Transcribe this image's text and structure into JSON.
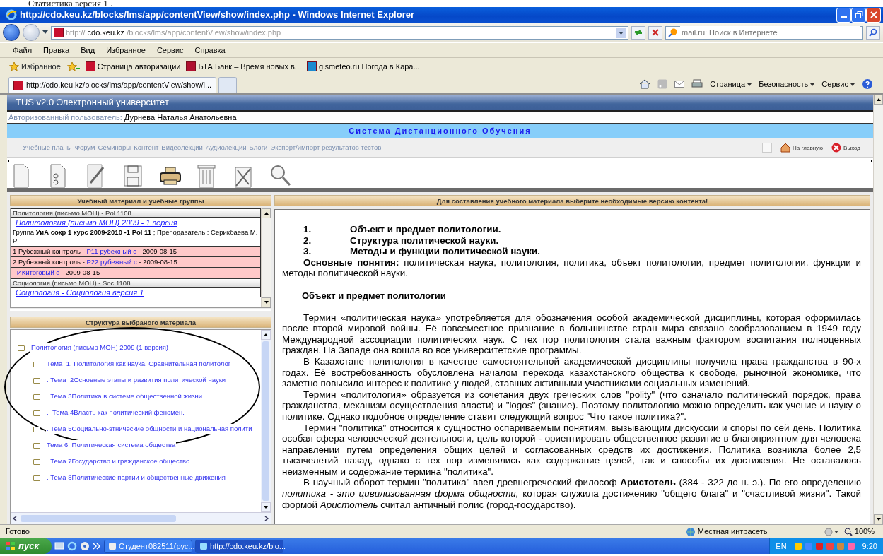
{
  "document_caption": "Статистика версия 1 .",
  "window": {
    "title": "http://cdo.keu.kz/blocks/lms/app/contentView/show/index.php - Windows Internet Explorer"
  },
  "address_bar": {
    "scheme": "http://",
    "host": "cdo.keu.kz",
    "path": "/blocks/lms/app/contentView/show/index.php"
  },
  "search": {
    "placeholder": "mail.ru: Поиск в Интернете"
  },
  "menu": [
    "Файл",
    "Правка",
    "Вид",
    "Избранное",
    "Сервис",
    "Справка"
  ],
  "favorites_bar": {
    "label": "Избранное",
    "links": [
      "Страница авторизации",
      "БТА Банк – Время новых в...",
      "gismeteo.ru Погода в Кара..."
    ]
  },
  "tabs": [
    {
      "label": "http://cdo.keu.kz/blocks/lms/app/contentView/show/i...",
      "selected": true
    }
  ],
  "command_bar": [
    "Страница",
    "Безопасность",
    "Сервис"
  ],
  "page": {
    "header": "TUS v2.0 Электронный университет",
    "user_label": "Авторизованный пользователь:",
    "user_name": "Дурнева Наталья Анатольевна",
    "system_title": "Система Дистанционного Обучения",
    "nav": [
      "Учебные планы",
      "Форум",
      "Семинары",
      "Контент",
      "Видеолекции",
      "Аудиолекции",
      "Блоги",
      "Экспорт/импорт результатов тестов"
    ],
    "home_link": "На главную",
    "logout_link": "Выход",
    "materials_panel": {
      "title": "Учебный материал и учебные группы",
      "rows": [
        {
          "kind": "header",
          "text": "Политология (письмо МОН) - Pol 1108"
        },
        {
          "kind": "link",
          "text": "Политология (письмо МОН) 2009 - 1 версия"
        },
        {
          "kind": "group",
          "text": "Группа **УиА сокр 1 курс 2009-2010 -1 Pol 11** ; Преподаватель : Серикбаева М. Р"
        },
        {
          "kind": "control",
          "prefix": "1 Рубежный контроль - ",
          "link": "P11 рубежный с",
          "suffix": " - 2009-08-15"
        },
        {
          "kind": "control",
          "prefix": "2 Рубежный контроль - ",
          "link": "P22 рубежный с",
          "suffix": " - 2009-08-15"
        },
        {
          "kind": "control",
          "prefix": "- ",
          "link": "ИКитоговый с",
          "suffix": " - 2009-08-15"
        },
        {
          "kind": "header",
          "text": "Социология (письмо МОН) - Soc 1108"
        },
        {
          "kind": "link",
          "text": "Социология - Социология версия 1"
        }
      ]
    },
    "structure_panel": {
      "title": "Структура выбраного материала",
      "tree": [
        {
          "label": "Политология (письмо МОН) 2009 (1 версия)",
          "children": [
            {
              "label": "Тема  1. Политология как наука. Сравнительная политолог"
            },
            {
              "label": ". Тема  2Основные этапы и развития политической науки"
            },
            {
              "label": ". Тема 3Политика в системе общественной жизни"
            },
            {
              "label": ".  Тема 4Власть как политический феномен."
            },
            {
              "label": ". Тема 5Социально-этнические общности и национальная полити"
            },
            {
              "label": "Тема 6. Политическая система общества"
            },
            {
              "label": ". Тема 7Государство и гражданское общество"
            },
            {
              "label": ". Тема 8Политические партии и общественные движения"
            }
          ]
        }
      ]
    },
    "content_panel": {
      "title": "Для составления учебного материала выберите необходимые версию контента!",
      "outline": [
        {
          "number": "1.",
          "text": "Объект и предмет политологии."
        },
        {
          "number": "2.",
          "text": "Структура политической науки."
        },
        {
          "number": "3.",
          "text": "Методы и функции политической науки."
        }
      ],
      "concepts": "**Основные понятия:** политическая наука, политология, политика, объект политологии, предмет политологии, функции и методы политической науки.",
      "heading": "Объект и предмет политологии",
      "paragraphs": [
        "Термин «политическая наука» употребляется для обозначения особой академической дисциплины, которая оформилась после второй мировой войны. Её повсеместное признание в большинстве стран мира связано сообразованием в 1949 году Международной ассоциации политических наук. С тех пор политология стала важным фактором воспитания полноценных граждан. На Западе она вошла во все университетские программы.",
        "В Казахстане политология в качестве самостоятельной академической дисциплины получила права гражданства в 90-х годах. Её востребованность  обусловлена началом перехода казахстанского общества к свободе, рыночной экономике, что заметно повысило интерес к политике у людей, ставших активными участниками социальных изменений.",
        "Термин «политология» образуется из сочетания двух греческих слов \"polity\" (что означало политический порядок, права гражданства, механизм осуществления власти) и \"logos\" (знание). Поэтому политологию можно определить как учение и науку о политике. Однако подобное определение ставит следующий вопрос \"Что такое политика?\".",
        "Термин \"политика\" относится к сущностно оспариваемым понятиям, вызывающим дискуссии и споры по сей день. Политика особая сфера человеческой деятельности, цель которой - ориентировать общественное развитие в благоприятном для человека направлении путем определения общих целей и согласованных средств их достижения. Политика возникла более 2,5 тысячелетий назад, однако с тех пор изменялись как содержание целей, так и способы их достижения. Не оставалось неизменным и содержание термина \"политика\".",
        "В научный оборот термин \"политика\" ввел древнегреческий философ **Аристотель** (384 - 322 до н. э.). По его определению *политика - это цивилизованная форма общности,* которая служила достижению \"общего блага\" и \"счастливой жизни\". Такой формой *Аристотель* считал античный полис (город-государство)."
      ]
    }
  },
  "status_bar": {
    "text": "Готово",
    "zone": "Местная интрасеть",
    "zoom": "100%"
  },
  "taskbar": {
    "start": "пуск",
    "windows": [
      {
        "label": "Студент082511(рус...",
        "selected": false
      },
      {
        "label": "http://cdo.keu.kz/blo...",
        "selected": true
      }
    ],
    "language": "EN",
    "time": "9:20"
  }
}
